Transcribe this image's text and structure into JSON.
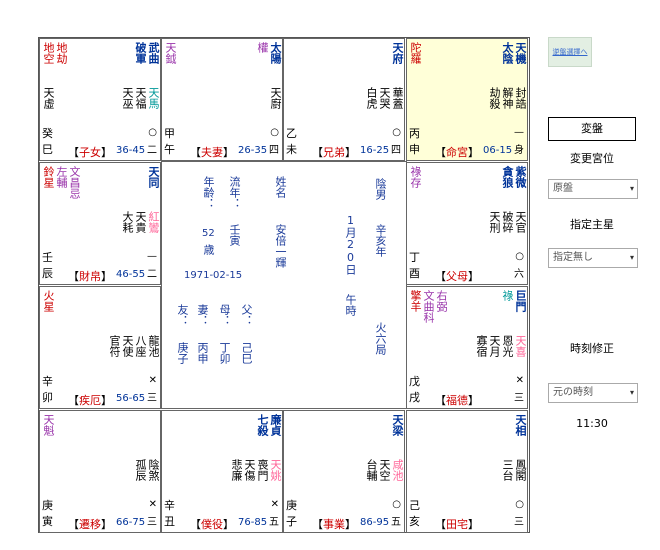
{
  "right_panel": {
    "top_link": "逆盤選擇へ",
    "kanban_button": "変盤",
    "change_palace_label": "変更宮位",
    "change_palace_select": "原盤",
    "specify_star_label": "指定主星",
    "specify_star_select": "指定無し",
    "time_fix_label": "時刻修正",
    "time_select": "元の時刻",
    "time_value": "11:30"
  },
  "center": {
    "age_label": "年齢：",
    "age_value": "52",
    "age_unit": "歳",
    "liunian_label": "流年：",
    "liunian_value": "壬寅",
    "birth_date": "1971-02-15",
    "name_label": "姓名",
    "name_value": "安倍一輝",
    "gender_label": "陰男",
    "lunar_date": "1月20日",
    "year_stem": "辛亥年",
    "hour_label": "午時",
    "bureau": "火六局",
    "relatives": [
      {
        "role": "友：",
        "gz": "庚子"
      },
      {
        "role": "妻：",
        "gz": "丙申"
      },
      {
        "role": "母：",
        "gz": "丁卯"
      },
      {
        "role": "父：",
        "gz": "己巳"
      }
    ]
  },
  "cells": [
    {
      "id": "si",
      "main": [
        {
          "t": "武曲",
          "c": "navy"
        },
        {
          "t": "破軍",
          "c": "navy"
        }
      ],
      "left": [
        {
          "t": "地空",
          "c": "red"
        },
        {
          "t": "地劫",
          "c": "red"
        }
      ],
      "small": [
        {
          "t": "天馬",
          "c": "green"
        },
        {
          "t": "天福",
          "c": "black"
        },
        {
          "t": "天巫",
          "c": "black"
        }
      ],
      "misc": [
        {
          "t": "天虛",
          "c": "black"
        }
      ],
      "circ": "○",
      "branch_num": "二",
      "stem1": "癸",
      "stem2": "巳",
      "palace": "子女",
      "range": "36-45"
    },
    {
      "id": "wu",
      "main": [
        {
          "t": "太陽",
          "c": "navy"
        },
        {
          "t": "權",
          "c": "purple"
        }
      ],
      "left": [
        {
          "t": "天鉞",
          "c": "purple"
        }
      ],
      "small": [
        {
          "t": "天廚",
          "c": "black"
        }
      ],
      "misc": [],
      "circ": "○",
      "branch_num": "四",
      "stem1": "甲",
      "stem2": "午",
      "palace": "夫妻",
      "range": "26-35"
    },
    {
      "id": "wei",
      "main": [
        {
          "t": "天府",
          "c": "navy"
        }
      ],
      "left": [],
      "small": [
        {
          "t": "華蓋",
          "c": "black"
        },
        {
          "t": "天哭",
          "c": "black"
        },
        {
          "t": "白虎",
          "c": "black"
        }
      ],
      "misc": [],
      "circ": "○",
      "branch_num": "四",
      "stem1": "乙",
      "stem2": "未",
      "palace": "兄弟",
      "range": "16-25"
    },
    {
      "id": "shen",
      "main": [
        {
          "t": "天機",
          "c": "navy"
        },
        {
          "t": "太陰",
          "c": "navy"
        }
      ],
      "left": [
        {
          "t": "陀羅",
          "c": "red"
        }
      ],
      "small": [
        {
          "t": "封誥",
          "c": "black"
        },
        {
          "t": "解神",
          "c": "black"
        },
        {
          "t": "劫殺",
          "c": "black"
        }
      ],
      "misc": [],
      "circ": "—",
      "branch_num": "身",
      "stem1": "丙",
      "stem2": "申",
      "palace": "命宮",
      "range": "06-15",
      "life": true
    },
    {
      "id": "chen",
      "main": [
        {
          "t": "天同",
          "c": "navy"
        }
      ],
      "left": [
        {
          "t": "鈴星",
          "c": "red"
        },
        {
          "t": "左輔",
          "c": "purple"
        },
        {
          "t": "文昌忌",
          "c": "purple"
        }
      ],
      "small": [
        {
          "t": "紅鸞",
          "c": "pink"
        },
        {
          "t": "天貴",
          "c": "black"
        },
        {
          "t": "大耗",
          "c": "black"
        }
      ],
      "misc": [],
      "circ": "—",
      "branch_num": "二",
      "stem1": "壬",
      "stem2": "辰",
      "palace": "財帛",
      "range": "46-55"
    },
    {
      "id": "you",
      "main": [
        {
          "t": "紫微",
          "c": "navy"
        },
        {
          "t": "貪狼",
          "c": "navy"
        }
      ],
      "left": [
        {
          "t": "祿存",
          "c": "purple"
        }
      ],
      "small": [
        {
          "t": "天官",
          "c": "black"
        },
        {
          "t": "破碎",
          "c": "black"
        },
        {
          "t": "天刑",
          "c": "black"
        }
      ],
      "misc": [],
      "circ": "○",
      "branch_num": "六",
      "stem1": "丁",
      "stem2": "酉",
      "palace": "父母",
      "range": ""
    },
    {
      "id": "mao",
      "main": [],
      "left": [
        {
          "t": "火星",
          "c": "red"
        }
      ],
      "small": [
        {
          "t": "龍池",
          "c": "black"
        },
        {
          "t": "八座",
          "c": "black"
        },
        {
          "t": "天使",
          "c": "black"
        },
        {
          "t": "官符",
          "c": "black"
        }
      ],
      "misc": [],
      "circ": "✕",
      "branch_num": "三",
      "stem1": "辛",
      "stem2": "卯",
      "palace": "疾厄",
      "range": "56-65"
    },
    {
      "id": "xu",
      "main": [
        {
          "t": "巨門",
          "c": "navy"
        },
        {
          "t": "祿",
          "c": "green"
        }
      ],
      "left": [
        {
          "t": "擎羊",
          "c": "red"
        },
        {
          "t": "文曲科",
          "c": "purple"
        },
        {
          "t": "右弼",
          "c": "purple"
        }
      ],
      "small": [
        {
          "t": "天喜",
          "c": "pink"
        },
        {
          "t": "恩光",
          "c": "black"
        },
        {
          "t": "天月",
          "c": "black"
        },
        {
          "t": "寡宿",
          "c": "black"
        }
      ],
      "misc": [],
      "circ": "✕",
      "branch_num": "三",
      "stem1": "戊",
      "stem2": "戌",
      "palace": "福德",
      "range": ""
    },
    {
      "id": "yin",
      "main": [],
      "left": [
        {
          "t": "天魁",
          "c": "purple"
        }
      ],
      "small": [
        {
          "t": "陰煞",
          "c": "black"
        },
        {
          "t": "孤辰",
          "c": "black"
        }
      ],
      "misc": [],
      "circ": "✕",
      "branch_num": "三",
      "stem1": "庚",
      "stem2": "寅",
      "palace": "遷移",
      "range": "66-75"
    },
    {
      "id": "chou",
      "main": [
        {
          "t": "廉貞",
          "c": "navy"
        },
        {
          "t": "七殺",
          "c": "navy"
        }
      ],
      "left": [],
      "small": [
        {
          "t": "天姚",
          "c": "pink"
        },
        {
          "t": "喪門",
          "c": "black"
        },
        {
          "t": "天傷",
          "c": "black"
        },
        {
          "t": "悲廉",
          "c": "black"
        }
      ],
      "misc": [],
      "circ": "✕",
      "branch_num": "五",
      "stem1": "辛",
      "stem2": "丑",
      "palace": "僕役",
      "range": "76-85"
    },
    {
      "id": "zi",
      "main": [
        {
          "t": "天梁",
          "c": "navy"
        }
      ],
      "left": [],
      "small": [
        {
          "t": "咸池",
          "c": "pink"
        },
        {
          "t": "天空",
          "c": "black"
        },
        {
          "t": "台輔",
          "c": "black"
        }
      ],
      "misc": [],
      "circ": "○",
      "branch_num": "五",
      "stem1": "庚",
      "stem2": "子",
      "palace": "事業",
      "range": "86-95"
    },
    {
      "id": "hai",
      "main": [
        {
          "t": "天相",
          "c": "navy"
        }
      ],
      "left": [],
      "small": [
        {
          "t": "鳳閣",
          "c": "black"
        },
        {
          "t": "三台",
          "c": "black"
        }
      ],
      "misc": [],
      "circ": "○",
      "branch_num": "三",
      "stem1": "己",
      "stem2": "亥",
      "palace": "田宅",
      "range": ""
    }
  ]
}
